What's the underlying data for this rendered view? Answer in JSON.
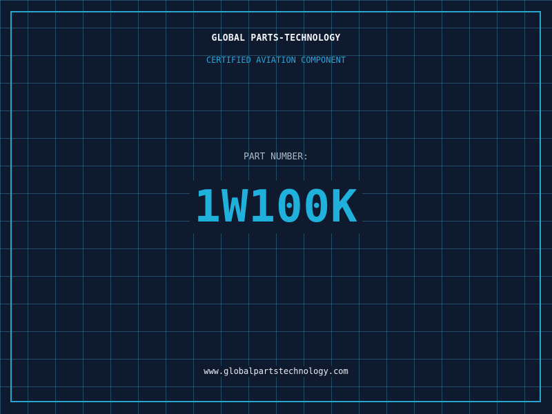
{
  "header": {
    "company": "GLOBAL PARTS-TECHNOLOGY",
    "tagline": "CERTIFIED AVIATION COMPONENT"
  },
  "part": {
    "label": "PART NUMBER:",
    "number": "1W100K"
  },
  "footer": {
    "url": "www.globalpartstechnology.com"
  },
  "colors": {
    "background": "#101a2f",
    "grid": "#38a0be",
    "frame": "#29a6cf",
    "accent": "#1fb0db"
  }
}
